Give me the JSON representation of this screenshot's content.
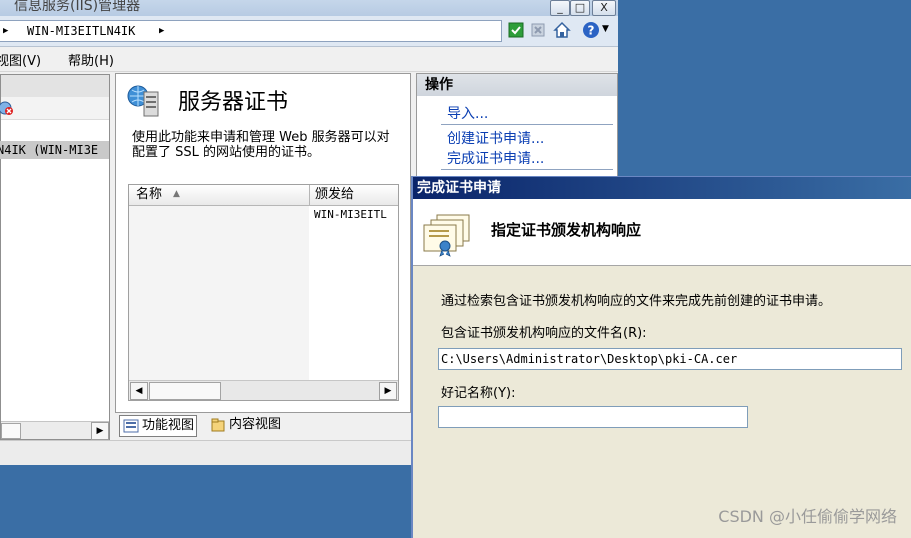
{
  "iis": {
    "title": "信息服务(IIS)管理器",
    "address": "WIN-MI3EITLN4IK",
    "minimize": "_",
    "maximize": "□",
    "close": "X",
    "menus": [
      "视图(V)",
      "帮助(H)"
    ],
    "tree_item": "N4IK (WIN-MI3E"
  },
  "center": {
    "title": "服务器证书",
    "description": "使用此功能来申请和管理 Web 服务器可以对配置了 SSL 的网站使用的证书。",
    "columns": [
      "名称",
      "颁发给"
    ],
    "rows": [
      {
        "name": "",
        "issued_to": "WIN-MI3EITL"
      }
    ],
    "views": [
      "功能视图",
      "内容视图"
    ]
  },
  "actions": {
    "header": "操作",
    "items": [
      "导入...",
      "创建证书申请...",
      "完成证书申请..."
    ]
  },
  "dialog": {
    "title": "完成证书申请",
    "heading": "指定证书颁发机构响应",
    "instruction": "通过检索包含证书颁发机构响应的文件来完成先前创建的证书申请。",
    "file_label": "包含证书颁发机构响应的文件名(R):",
    "file_value": "C:\\Users\\Administrator\\Desktop\\pki-CA.cer",
    "friendly_label": "好记名称(Y):",
    "friendly_value": ""
  },
  "watermark": "CSDN @小任偷偷学网络",
  "colors": {
    "desktop": "#3a6ea5",
    "link": "#0b3fb3",
    "dialog_title": "#0a246a"
  }
}
